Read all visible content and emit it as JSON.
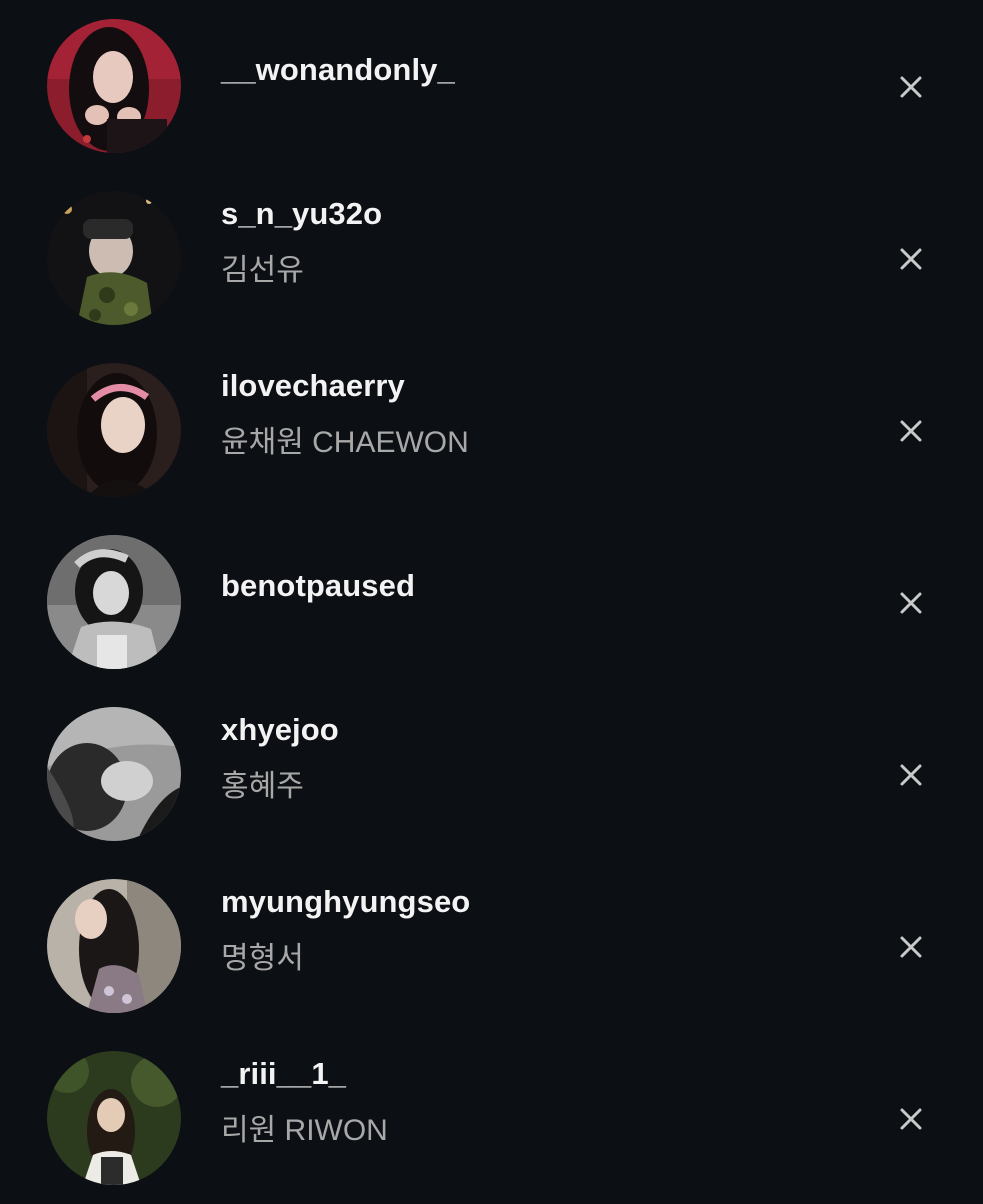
{
  "accounts": [
    {
      "username": "__wonandonly_",
      "name": "",
      "avatar_icon": "profile-photo"
    },
    {
      "username": "s_n_yu32o",
      "name": "김선유",
      "avatar_icon": "profile-photo"
    },
    {
      "username": "ilovechaerry",
      "name": "윤채원 CHAEWON",
      "avatar_icon": "profile-photo"
    },
    {
      "username": "benotpaused",
      "name": "",
      "avatar_icon": "profile-photo"
    },
    {
      "username": "xhyejoo",
      "name": "홍혜주",
      "avatar_icon": "profile-photo"
    },
    {
      "username": "myunghyungseo",
      "name": "명형서",
      "avatar_icon": "profile-photo"
    },
    {
      "username": "_riii__1_",
      "name": "리원 RIWON",
      "avatar_icon": "profile-photo"
    }
  ],
  "remove_icon": "close-icon",
  "colors": {
    "background": "#0c0f14",
    "username": "#f3f3f3",
    "fullname": "#a8a8a8",
    "close": "#c9c9c9"
  }
}
